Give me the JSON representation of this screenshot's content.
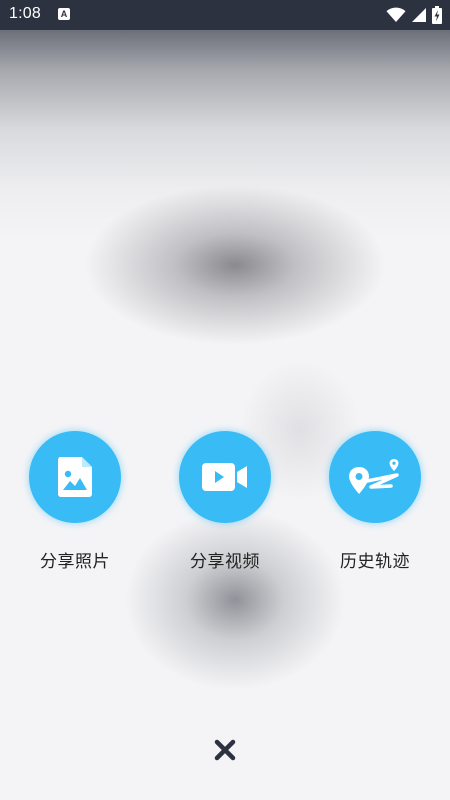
{
  "status_bar": {
    "time": "1:08",
    "notification_badge": "A",
    "icons": [
      "wifi-icon",
      "signal-icon",
      "battery-charging-icon"
    ]
  },
  "actions": [
    {
      "label": "分享照片",
      "icon": "image-file-icon"
    },
    {
      "label": "分享视频",
      "icon": "video-camera-icon"
    },
    {
      "label": "历史轨迹",
      "icon": "route-track-icon"
    }
  ],
  "close": {
    "icon": "close-icon"
  },
  "colors": {
    "accent": "#39bbf6",
    "status_bar": "#2d3240",
    "label_text": "#222222",
    "close_icon": "#2d3240"
  }
}
